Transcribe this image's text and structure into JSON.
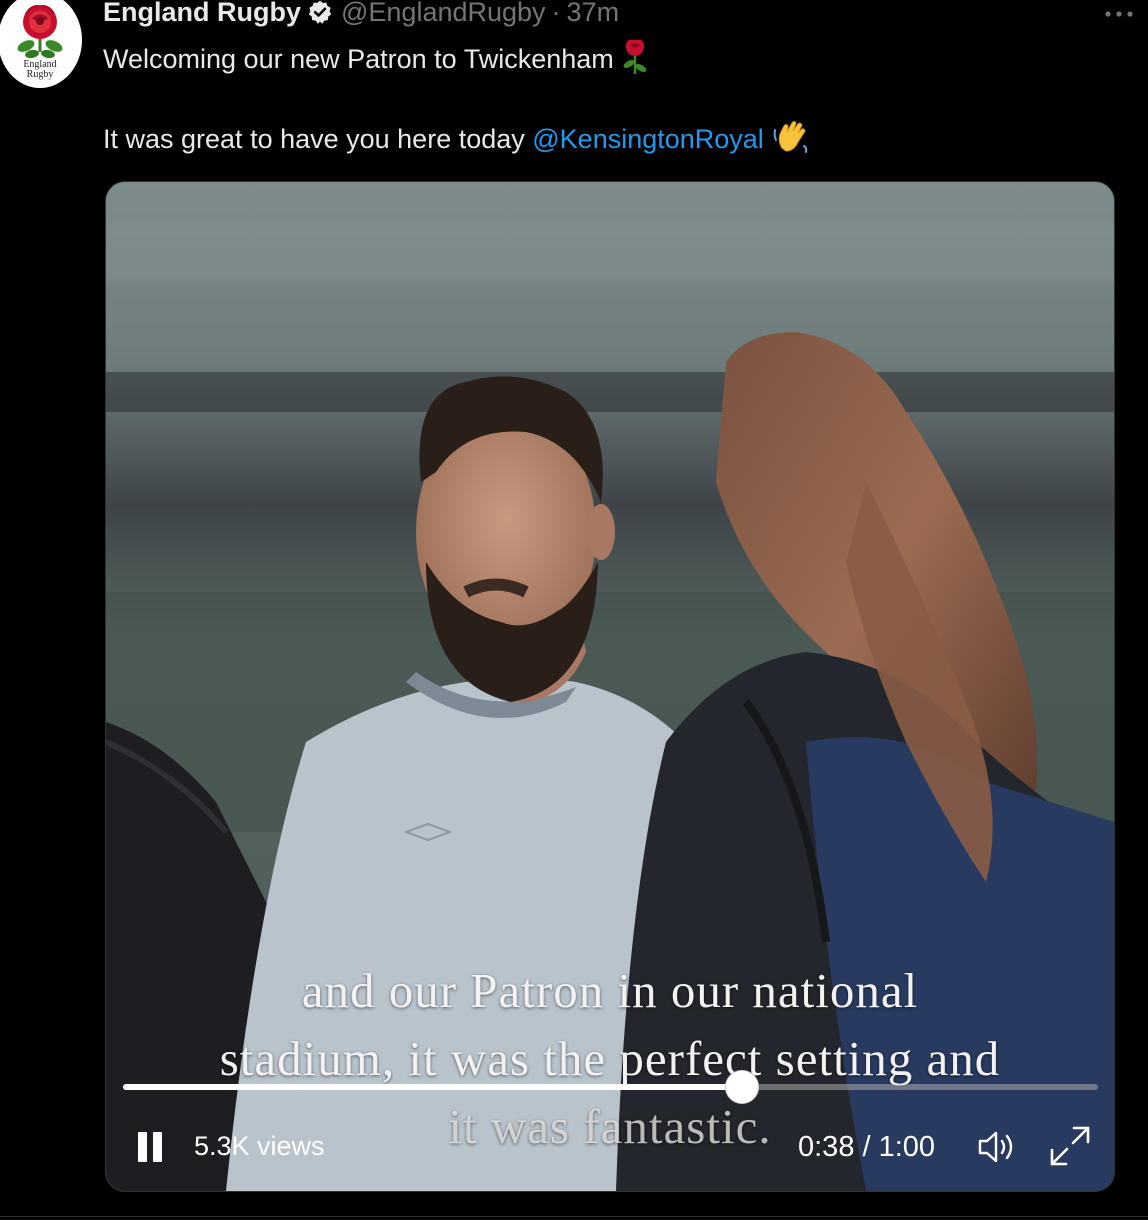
{
  "tweet": {
    "avatar_text_1": "England",
    "avatar_text_2": "Rugby",
    "display_name": "England Rugby",
    "handle": "@EnglandRugby",
    "separator": "·",
    "time": "37m",
    "more_icon": "more-horizontal-icon",
    "line1": "Welcoming our new Patron to Twickenham",
    "line2_prefix": "It was great to have you here today ",
    "mention": "@KensingtonRoyal",
    "emojis": [
      "rose-emoji",
      "waving-hand-emoji"
    ]
  },
  "video": {
    "captions": [
      "and our Patron in our national",
      "stadium, it was the perfect setting and",
      "it was fantastic."
    ],
    "progress_fraction": 0.635,
    "views": "5.3K views",
    "time_readout": "0:38 / 1:00",
    "icons": [
      "pause-icon",
      "volume-icon",
      "fullscreen-icon"
    ]
  },
  "colors": {
    "background": "#000000",
    "text": "#e7e9ea",
    "secondary_text": "#71767b",
    "link": "#1d9bf0",
    "verified": "#e7e9ea"
  }
}
